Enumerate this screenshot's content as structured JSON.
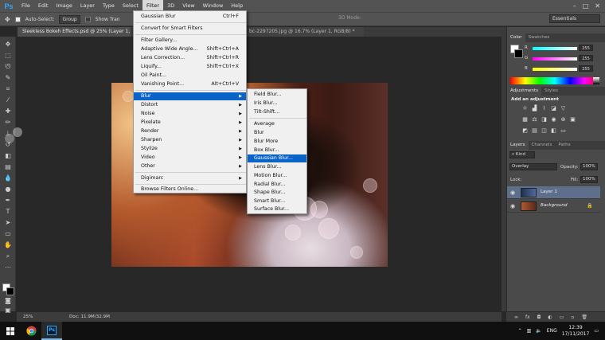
{
  "app": {
    "logo": "Ps"
  },
  "menubar": {
    "items": [
      "File",
      "Edit",
      "Image",
      "Layer",
      "Type",
      "Select",
      "Filter",
      "3D",
      "View",
      "Window",
      "Help"
    ],
    "active": "Filter",
    "window_controls": [
      "–",
      "□",
      "✕"
    ]
  },
  "options_bar": {
    "auto_select_label": "Auto-Select:",
    "auto_select_value": "Group",
    "show_transform_label": "Show Tran",
    "mode_3d_label": "3D Mode:",
    "workspace": "Essentials"
  },
  "tabs": [
    {
      "label": "Sleekless Bokeh Effects.psd @ 25% (Layer 1, RG"
    },
    {
      "label": "bc-2297205.jpg @ 16.7% (Layer 1, RGB/8) *"
    }
  ],
  "filter_menu": {
    "items": [
      {
        "label": "Gaussian Blur",
        "shortcut": "Ctrl+F"
      },
      {
        "label": "Convert for Smart Filters"
      },
      {
        "label": "Filter Gallery..."
      },
      {
        "label": "Adaptive Wide Angle...",
        "shortcut": "Shift+Ctrl+A"
      },
      {
        "label": "Lens Correction...",
        "shortcut": "Shift+Ctrl+R"
      },
      {
        "label": "Liquify...",
        "shortcut": "Shift+Ctrl+X"
      },
      {
        "label": "Oil Paint..."
      },
      {
        "label": "Vanishing Point...",
        "shortcut": "Alt+Ctrl+V"
      },
      {
        "label": "Blur",
        "submenu": true,
        "highlighted": true
      },
      {
        "label": "Distort",
        "submenu": true
      },
      {
        "label": "Noise",
        "submenu": true
      },
      {
        "label": "Pixelate",
        "submenu": true
      },
      {
        "label": "Render",
        "submenu": true
      },
      {
        "label": "Sharpen",
        "submenu": true
      },
      {
        "label": "Stylize",
        "submenu": true
      },
      {
        "label": "Video",
        "submenu": true
      },
      {
        "label": "Other",
        "submenu": true
      },
      {
        "label": "Digimarc",
        "submenu": true
      },
      {
        "label": "Browse Filters Online..."
      }
    ]
  },
  "blur_menu": {
    "items": [
      {
        "label": "Field Blur..."
      },
      {
        "label": "Iris Blur..."
      },
      {
        "label": "Tilt-Shift..."
      },
      {
        "label": "Average"
      },
      {
        "label": "Blur"
      },
      {
        "label": "Blur More"
      },
      {
        "label": "Box Blur..."
      },
      {
        "label": "Gaussian Blur...",
        "highlighted": true
      },
      {
        "label": "Lens Blur..."
      },
      {
        "label": "Motion Blur..."
      },
      {
        "label": "Radial Blur..."
      },
      {
        "label": "Shape Blur..."
      },
      {
        "label": "Smart Blur..."
      },
      {
        "label": "Surface Blur..."
      }
    ]
  },
  "color_panel": {
    "tabs": [
      "Color",
      "Swatches"
    ],
    "channels": [
      {
        "label": "R",
        "value": "255",
        "color": "#ff3b3b"
      },
      {
        "label": "G",
        "value": "255",
        "color": "#e040e0"
      },
      {
        "label": "B",
        "value": "255",
        "color": "#e8e020"
      }
    ]
  },
  "adjustments_panel": {
    "tabs": [
      "Adjustments",
      "Styles"
    ],
    "heading": "Add an adjustment"
  },
  "layers_panel": {
    "tabs": [
      "Layers",
      "Channels",
      "Paths"
    ],
    "kind_label": "Kind",
    "blend_mode": "Overlay",
    "opacity_label": "Opacity:",
    "opacity_value": "100%",
    "lock_label": "Lock:",
    "fill_label": "Fill:",
    "fill_value": "100%",
    "layers": [
      {
        "name": "Layer 1",
        "selected": true
      },
      {
        "name": "Background",
        "selected": false
      }
    ]
  },
  "status": {
    "zoom": "25%",
    "doc": "Doc: 11.9M/32.9M"
  },
  "taskbar": {
    "language": "ENG",
    "time": "12:39",
    "date": "17/11/2017"
  },
  "colors": {
    "menu_highlight": "#0a64c8",
    "ps_blue": "#31a8ff",
    "layer_selected": "#5d6f8a"
  }
}
